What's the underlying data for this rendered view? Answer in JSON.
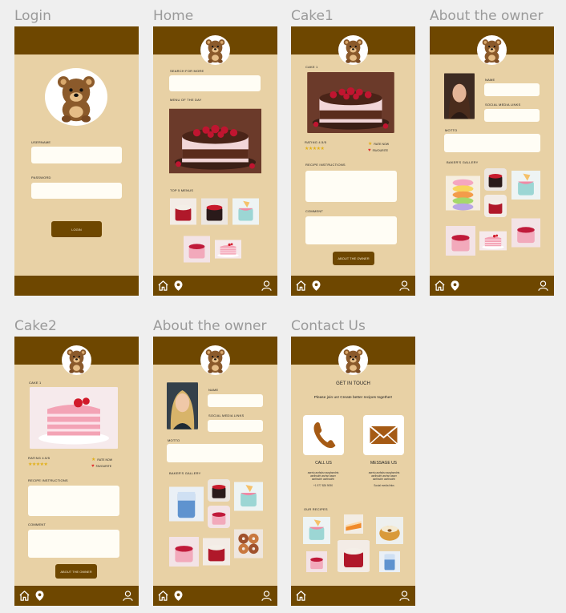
{
  "frames": {
    "login": {
      "title": "Login",
      "username_label": "USERNAME",
      "password_label": "PASSWORD",
      "login_button": "LOGIN"
    },
    "home": {
      "title": "Home",
      "search_label": "SEARCH FOR MORE",
      "menu_label": "MENU OF THE DAY",
      "top_label": "TOP 5 MENUS"
    },
    "cake1": {
      "title": "Cake1",
      "cake_label": "CAKE 1",
      "rating_label": "RATING 4.5/5",
      "stars": "★★★★★",
      "rate_now": "RATE NOW",
      "favourite": "FAVOURITE",
      "recipe_label": "RECIPE INSTRUCTIONS",
      "comment_label": "COMMENT",
      "about_button": "ABOUT THE OWNER"
    },
    "about1": {
      "title": "About the owner",
      "name_label": "NAME",
      "social_label": "SOCIAL MEDIA LINKS",
      "motto_label": "MOTTO",
      "gallery_label": "BAKER'S GALLERY"
    },
    "cake2": {
      "title": "Cake2",
      "cake_label": "CAKE 1",
      "rating_label": "RATING 4.5/5",
      "stars": "★★★★★",
      "rate_now": "RATE NOW",
      "favourite": "FAVOURITE",
      "recipe_label": "RECIPE INSTRUCTIONS",
      "comment_label": "COMMENT",
      "about_button": "ABOUT THE OWNER"
    },
    "about2": {
      "title": "About the owner",
      "name_label": "NAME",
      "social_label": "SOCIAL MEDIA LINKS",
      "motto_label": "MOTTO",
      "gallery_label": "BAKER'S GALLERY"
    },
    "contact": {
      "title": "Contact Us",
      "heading": "GET IN TOUCH",
      "subheading": "Please join us! Create better recipes together!",
      "call_label": "CALL US",
      "message_label": "MESSAGE US",
      "call_text_1": "asertu asrfsdsr asrghsedrts",
      "call_text_2": "asrthsdrh asrhsr asser",
      "call_text_3": "asrthsdrh asrthsdrth",
      "call_phone": "+1 977 826 9090",
      "msg_text_1": "asertu asrfsdsr asrghsedrts",
      "msg_text_2": "asrthsdrh asrhsr asser",
      "msg_text_3": "asrthsdrh asrthsdrth",
      "msg_social": "Social media links",
      "recipes_label": "OUR RECIPES"
    }
  },
  "colors": {
    "header": "#6e4700",
    "frame_bg": "#e8d1a5",
    "input_bg": "#fffdf5",
    "star": "#e2b019",
    "heart": "#e03030"
  },
  "icons": [
    "home-icon",
    "location-pin-icon",
    "user-icon",
    "phone-icon",
    "mail-icon",
    "bear-logo-icon",
    "star-icon",
    "heart-icon"
  ]
}
